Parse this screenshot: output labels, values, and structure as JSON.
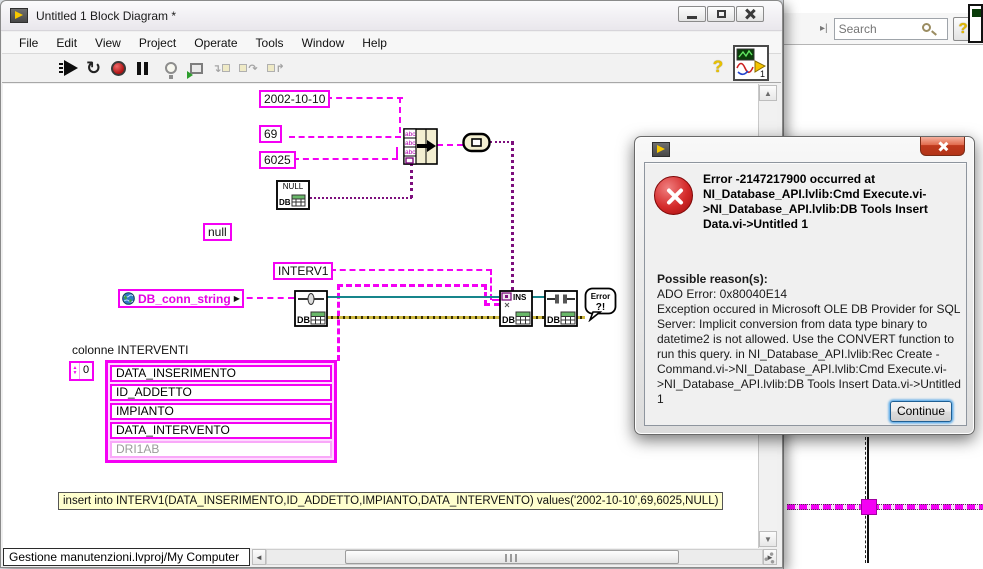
{
  "main_window": {
    "title": "Untitled 1 Block Diagram *",
    "menu": [
      "File",
      "Edit",
      "View",
      "Project",
      "Operate",
      "Tools",
      "Window",
      "Help"
    ],
    "help_label": "?",
    "vi_badge": "1",
    "status_path": "Gestione manutenzioni.lvproj/My Computer"
  },
  "bg_window": {
    "search_placeholder": "Search",
    "help_label": "?"
  },
  "diagram": {
    "const_date": "2002-10-10",
    "const_id": "69",
    "const_impianto": "6025",
    "null_db_top": "NULL",
    "db_label": "DB",
    "const_null": "null",
    "const_table": "INTERV1",
    "global_label": "DB_conn_string",
    "build_cell": "abc",
    "ins_label": "INS",
    "error_bubble_line1": "Error",
    "error_bubble_line2": "?!",
    "array_label": "colonne INTERVENTI",
    "array_index": "0",
    "array_items": [
      "DATA_INSERIMENTO",
      "ID_ADDETTO",
      "IMPIANTO",
      "DATA_INTERVENTO"
    ],
    "array_ghost_item": "DRI1AB",
    "sql_label": "insert into INTERV1(DATA_INSERIMENTO,ID_ADDETTO,IMPIANTO,DATA_INTERVENTO) values('2002-10-10',69,6025,NULL)"
  },
  "dialog": {
    "header": "Error -2147217900 occurred at NI_Database_API.lvlib:Cmd Execute.vi->NI_Database_API.lvlib:DB Tools Insert Data.vi->Untitled 1",
    "reasons_label": "Possible reason(s):",
    "ado_line": "ADO Error: 0x80040E14",
    "body": "Exception occured in Microsoft OLE DB Provider for SQL Server: Implicit conversion from data type binary to datetime2 is not allowed. Use the CONVERT function to run this query. in NI_Database_API.lvlib:Rec Create - Command.vi->NI_Database_API.lvlib:Cmd Execute.vi->NI_Database_API.lvlib:DB Tools Insert Data.vi->Untitled 1",
    "continue_label": "Continue"
  },
  "icons": {
    "scroll_up": "▲",
    "scroll_down": "▼",
    "scroll_left": "◄",
    "scroll_right": "►",
    "spinner_up": "▲",
    "spinner_down": "▼",
    "splitter": "▸|",
    "global_arrow": "▶",
    "continuous_run": "↻"
  },
  "colors": {
    "string_wire_pink": "#F400F4",
    "variant_wire_purple": "#7D0E7D",
    "connection_wire_teal": "#17858B",
    "error_wire_yellow": "#CDB83F",
    "dialog_close_red": "#C03A1E",
    "error_icon_red": "#D42A2A"
  }
}
